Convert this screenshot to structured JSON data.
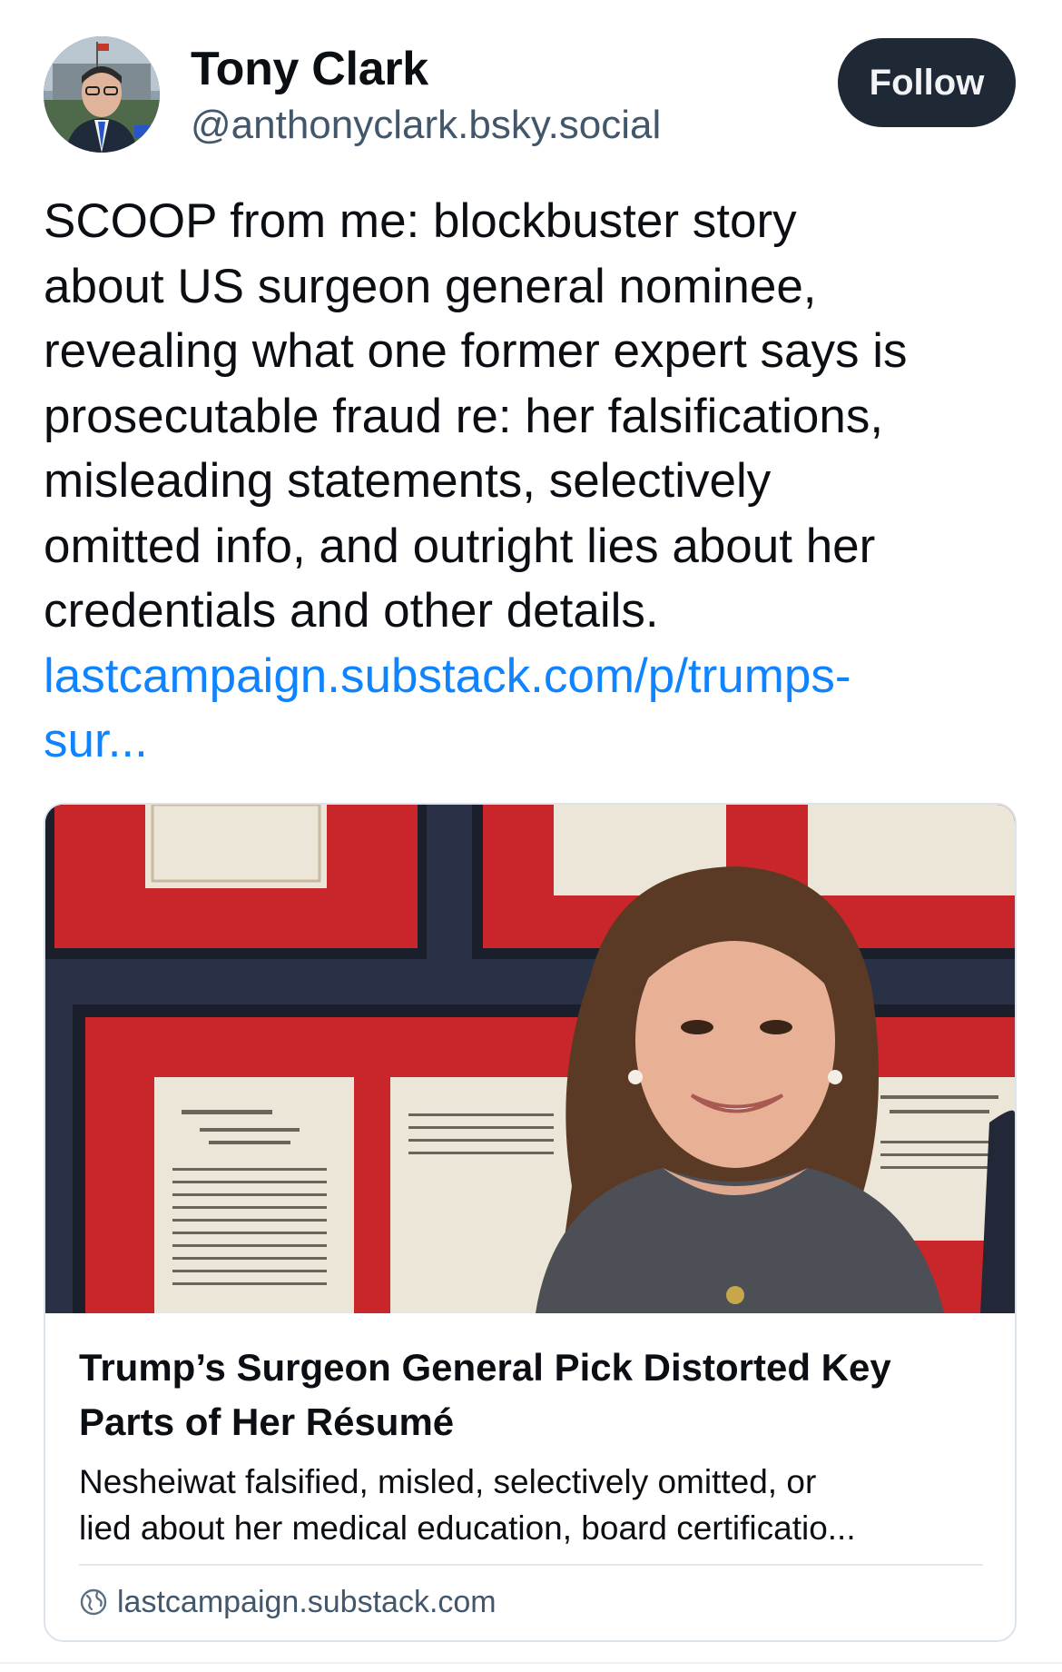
{
  "author": {
    "name": "Tony Clark",
    "handle": "@anthonyclark.bsky.social",
    "avatar_icon": "avatar-photo"
  },
  "follow_button": {
    "label": "Follow"
  },
  "post": {
    "text_lines": [
      "SCOOP from me: blockbuster story",
      "about US surgeon general nominee,",
      "revealing what one former expert says is",
      "prosecutable fraud re: her falsifications,",
      "misleading statements, selectively",
      "omitted info, and outright lies about her",
      "credentials and other details."
    ],
    "link_lines": [
      "lastcampaign.substack.com/p/trumps-",
      "sur..."
    ],
    "link_color": "#1083fe"
  },
  "embed": {
    "title": "Trump’s Surgeon General Pick Distorted Key Parts of Her Résumé",
    "description_lines": [
      "Nesheiwat falsified, misled, selectively omitted, or",
      "lied about her medical education, board certificatio..."
    ],
    "domain": "lastcampaign.substack.com",
    "domain_icon": "globe-icon",
    "image_icon": "article-photo"
  },
  "colors": {
    "follow_bg": "#1e2935",
    "handle": "#42576c",
    "text": "#0b0f14",
    "card_border": "#dde3ea"
  }
}
